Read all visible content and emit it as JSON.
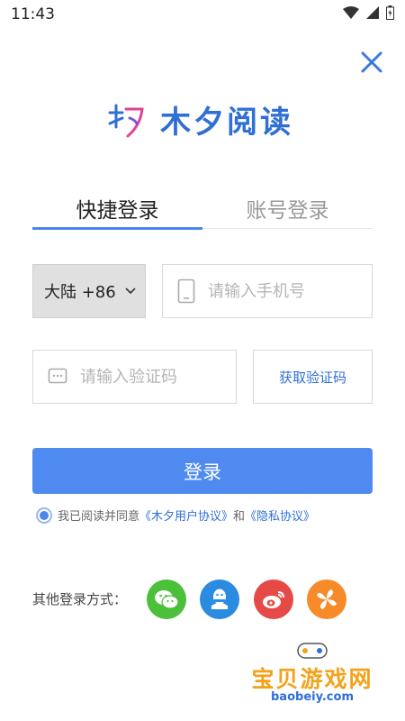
{
  "status_bar": {
    "time": "11:43"
  },
  "logo": {
    "text": "木夕阅读"
  },
  "tabs": [
    {
      "label": "快捷登录",
      "active": true
    },
    {
      "label": "账号登录",
      "active": false
    }
  ],
  "region": {
    "label": "大陆 +86"
  },
  "phone": {
    "placeholder": "请输入手机号",
    "value": ""
  },
  "code": {
    "placeholder": "请输入验证码",
    "value": ""
  },
  "get_code": {
    "label": "获取验证码"
  },
  "login": {
    "label": "登录"
  },
  "agreement": {
    "prefix": "我已阅读并同意",
    "link1": "《木夕用户协议》",
    "and": "和",
    "link2": "《隐私协议》"
  },
  "other_login": {
    "label": "其他登录方式：",
    "providers": [
      "wechat-icon",
      "qq-icon",
      "weibo-icon",
      "pinwheel-icon"
    ]
  },
  "watermark": {
    "title": "宝贝游戏网",
    "url": "baobeiy.com"
  },
  "colors": {
    "accent": "#4f8af0",
    "link": "#2f6fd6",
    "wechat": "#4cbf3b",
    "qq": "#2a8be0",
    "weibo": "#e54a46",
    "other": "#f78b2a"
  }
}
